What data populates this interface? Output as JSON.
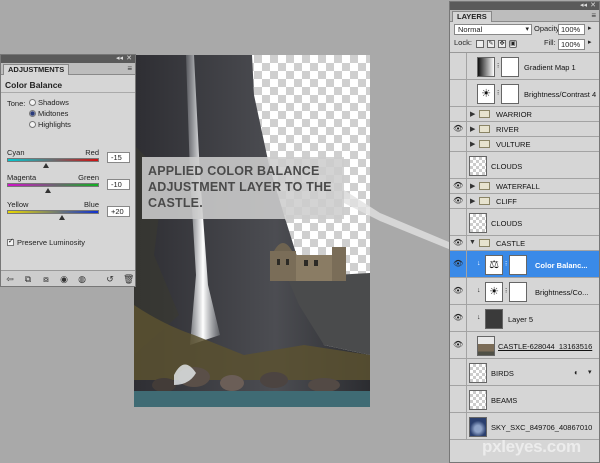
{
  "adjustments": {
    "tab_label": "ADJUSTMENTS",
    "title": "Color Balance",
    "tone_label": "Tone:",
    "tones": [
      {
        "label": "Shadows",
        "selected": false
      },
      {
        "label": "Midtones",
        "selected": true
      },
      {
        "label": "Highlights",
        "selected": false
      }
    ],
    "sliders": [
      {
        "left": "Cyan",
        "right": "Red",
        "value": "-15",
        "position_fraction": 0.425,
        "gradient": [
          "#00c8d0",
          "#d01010"
        ]
      },
      {
        "left": "Magenta",
        "right": "Green",
        "value": "-10",
        "position_fraction": 0.45,
        "gradient": [
          "#d010c8",
          "#10b020"
        ]
      },
      {
        "left": "Yellow",
        "right": "Blue",
        "value": "+20",
        "position_fraction": 0.6,
        "gradient": [
          "#e8d800",
          "#1030d0"
        ]
      }
    ],
    "preserve_luminosity_label": "Preserve Luminosity",
    "preserve_luminosity_checked": true
  },
  "callout": {
    "text": "APPLIED COLOR BALANCE\nADJUSTMENT LAYER TO THE\nCASTLE."
  },
  "layers": {
    "tab_label": "LAYERS",
    "blend_mode": "Normal",
    "opacity_label": "Opacity:",
    "opacity_value": "100%",
    "lock_label": "Lock:",
    "fill_label": "Fill:",
    "fill_value": "100%",
    "items": [
      {
        "name": "Gradient Map 1",
        "visible": false,
        "kind": "adjustment-gradient"
      },
      {
        "name": "Brightness/Contrast 4",
        "visible": false,
        "kind": "adjustment"
      },
      {
        "name": "WARRIOR",
        "visible": false,
        "kind": "group"
      },
      {
        "name": "RIVER",
        "visible": true,
        "kind": "group"
      },
      {
        "name": "VULTURE",
        "visible": false,
        "kind": "group"
      },
      {
        "name": "CLOUDS",
        "visible": false,
        "kind": "pixel"
      },
      {
        "name": "WATERFALL",
        "visible": true,
        "kind": "group"
      },
      {
        "name": "CLIFF",
        "visible": true,
        "kind": "group"
      },
      {
        "name": "CLOUDS",
        "visible": false,
        "kind": "pixel"
      },
      {
        "name": "CASTLE",
        "visible": true,
        "kind": "group-open"
      },
      {
        "name": "Color Balanc...",
        "visible": true,
        "kind": "adjustment-selected"
      },
      {
        "name": "Brightness/Co...",
        "visible": true,
        "kind": "adjustment-clipped"
      },
      {
        "name": "Layer 5",
        "visible": true,
        "kind": "pixel-clipped"
      },
      {
        "name": "CASTLE-628044_13163516",
        "visible": true,
        "kind": "pixel-castle"
      },
      {
        "name": "BIRDS",
        "visible": false,
        "kind": "pixel-fx"
      },
      {
        "name": "BEAMS",
        "visible": false,
        "kind": "pixel"
      },
      {
        "name": "SKY_SXC_849706_40867010",
        "visible": false,
        "kind": "pixel-sky"
      }
    ]
  },
  "watermark": "pxleyes.com",
  "icons": {
    "eye": "eye-icon",
    "folder": "folder-icon",
    "link": "chain-link-icon"
  }
}
